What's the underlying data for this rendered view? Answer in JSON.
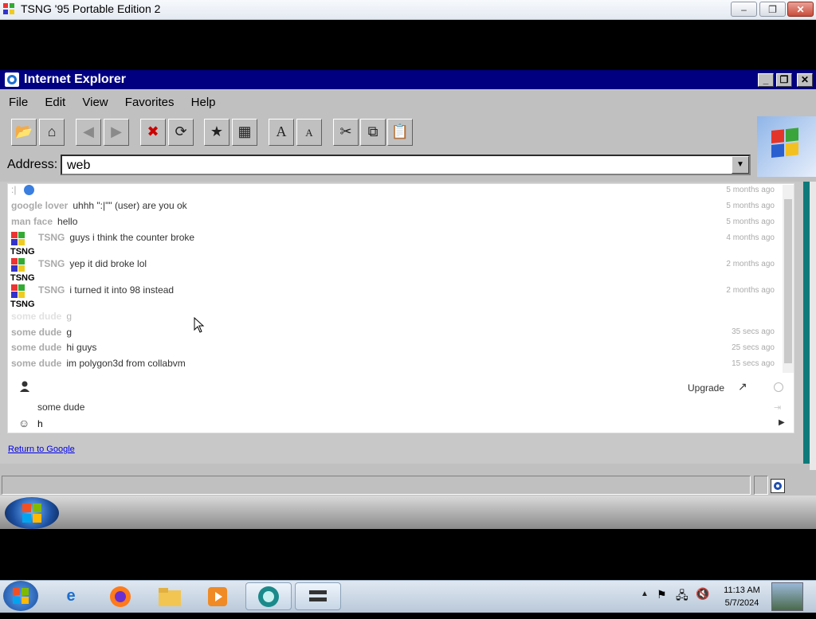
{
  "outer_window": {
    "title": "TSNG '95 Portable Edition 2",
    "min": "–",
    "max": "❐",
    "close": "✕"
  },
  "ie": {
    "title": "Internet Explorer",
    "min": "_",
    "max": "❐",
    "close": "✕",
    "menu": [
      "File",
      "Edit",
      "View",
      "Favorites",
      "Help"
    ],
    "address_label": "Address:",
    "address_value": "web"
  },
  "chat": {
    "messages": [
      {
        "user": ":|",
        "text": "",
        "time": "5 months ago"
      },
      {
        "user": "google lover",
        "text": "uhhh \":|\"\" (user) are you ok",
        "time": "5 months ago"
      },
      {
        "user": "man face",
        "text": "hello",
        "time": "5 months ago"
      },
      {
        "user": "TSNG",
        "text": "guys i think the counter broke",
        "time": "4 months ago"
      },
      {
        "user": "TSNG",
        "text": "yep it did broke lol",
        "time": "2 months ago"
      },
      {
        "user": "TSNG",
        "text": "i turned it into 98 instead",
        "time": "2 months ago"
      },
      {
        "user": "some dude",
        "text": "g",
        "time": ""
      },
      {
        "user": "some dude",
        "text": "g",
        "time": "35 secs ago"
      },
      {
        "user": "some dude",
        "text": "hi guys",
        "time": "25 secs ago"
      },
      {
        "user": "some dude",
        "text": "im polygon3d from collabvm",
        "time": "15 secs ago"
      }
    ],
    "upgrade_label": "Upgrade",
    "name_value": "some dude",
    "input_value": "h"
  },
  "return_link": "Return to Google",
  "taskbar": {
    "time": "11:13 AM",
    "date": "5/7/2024"
  }
}
